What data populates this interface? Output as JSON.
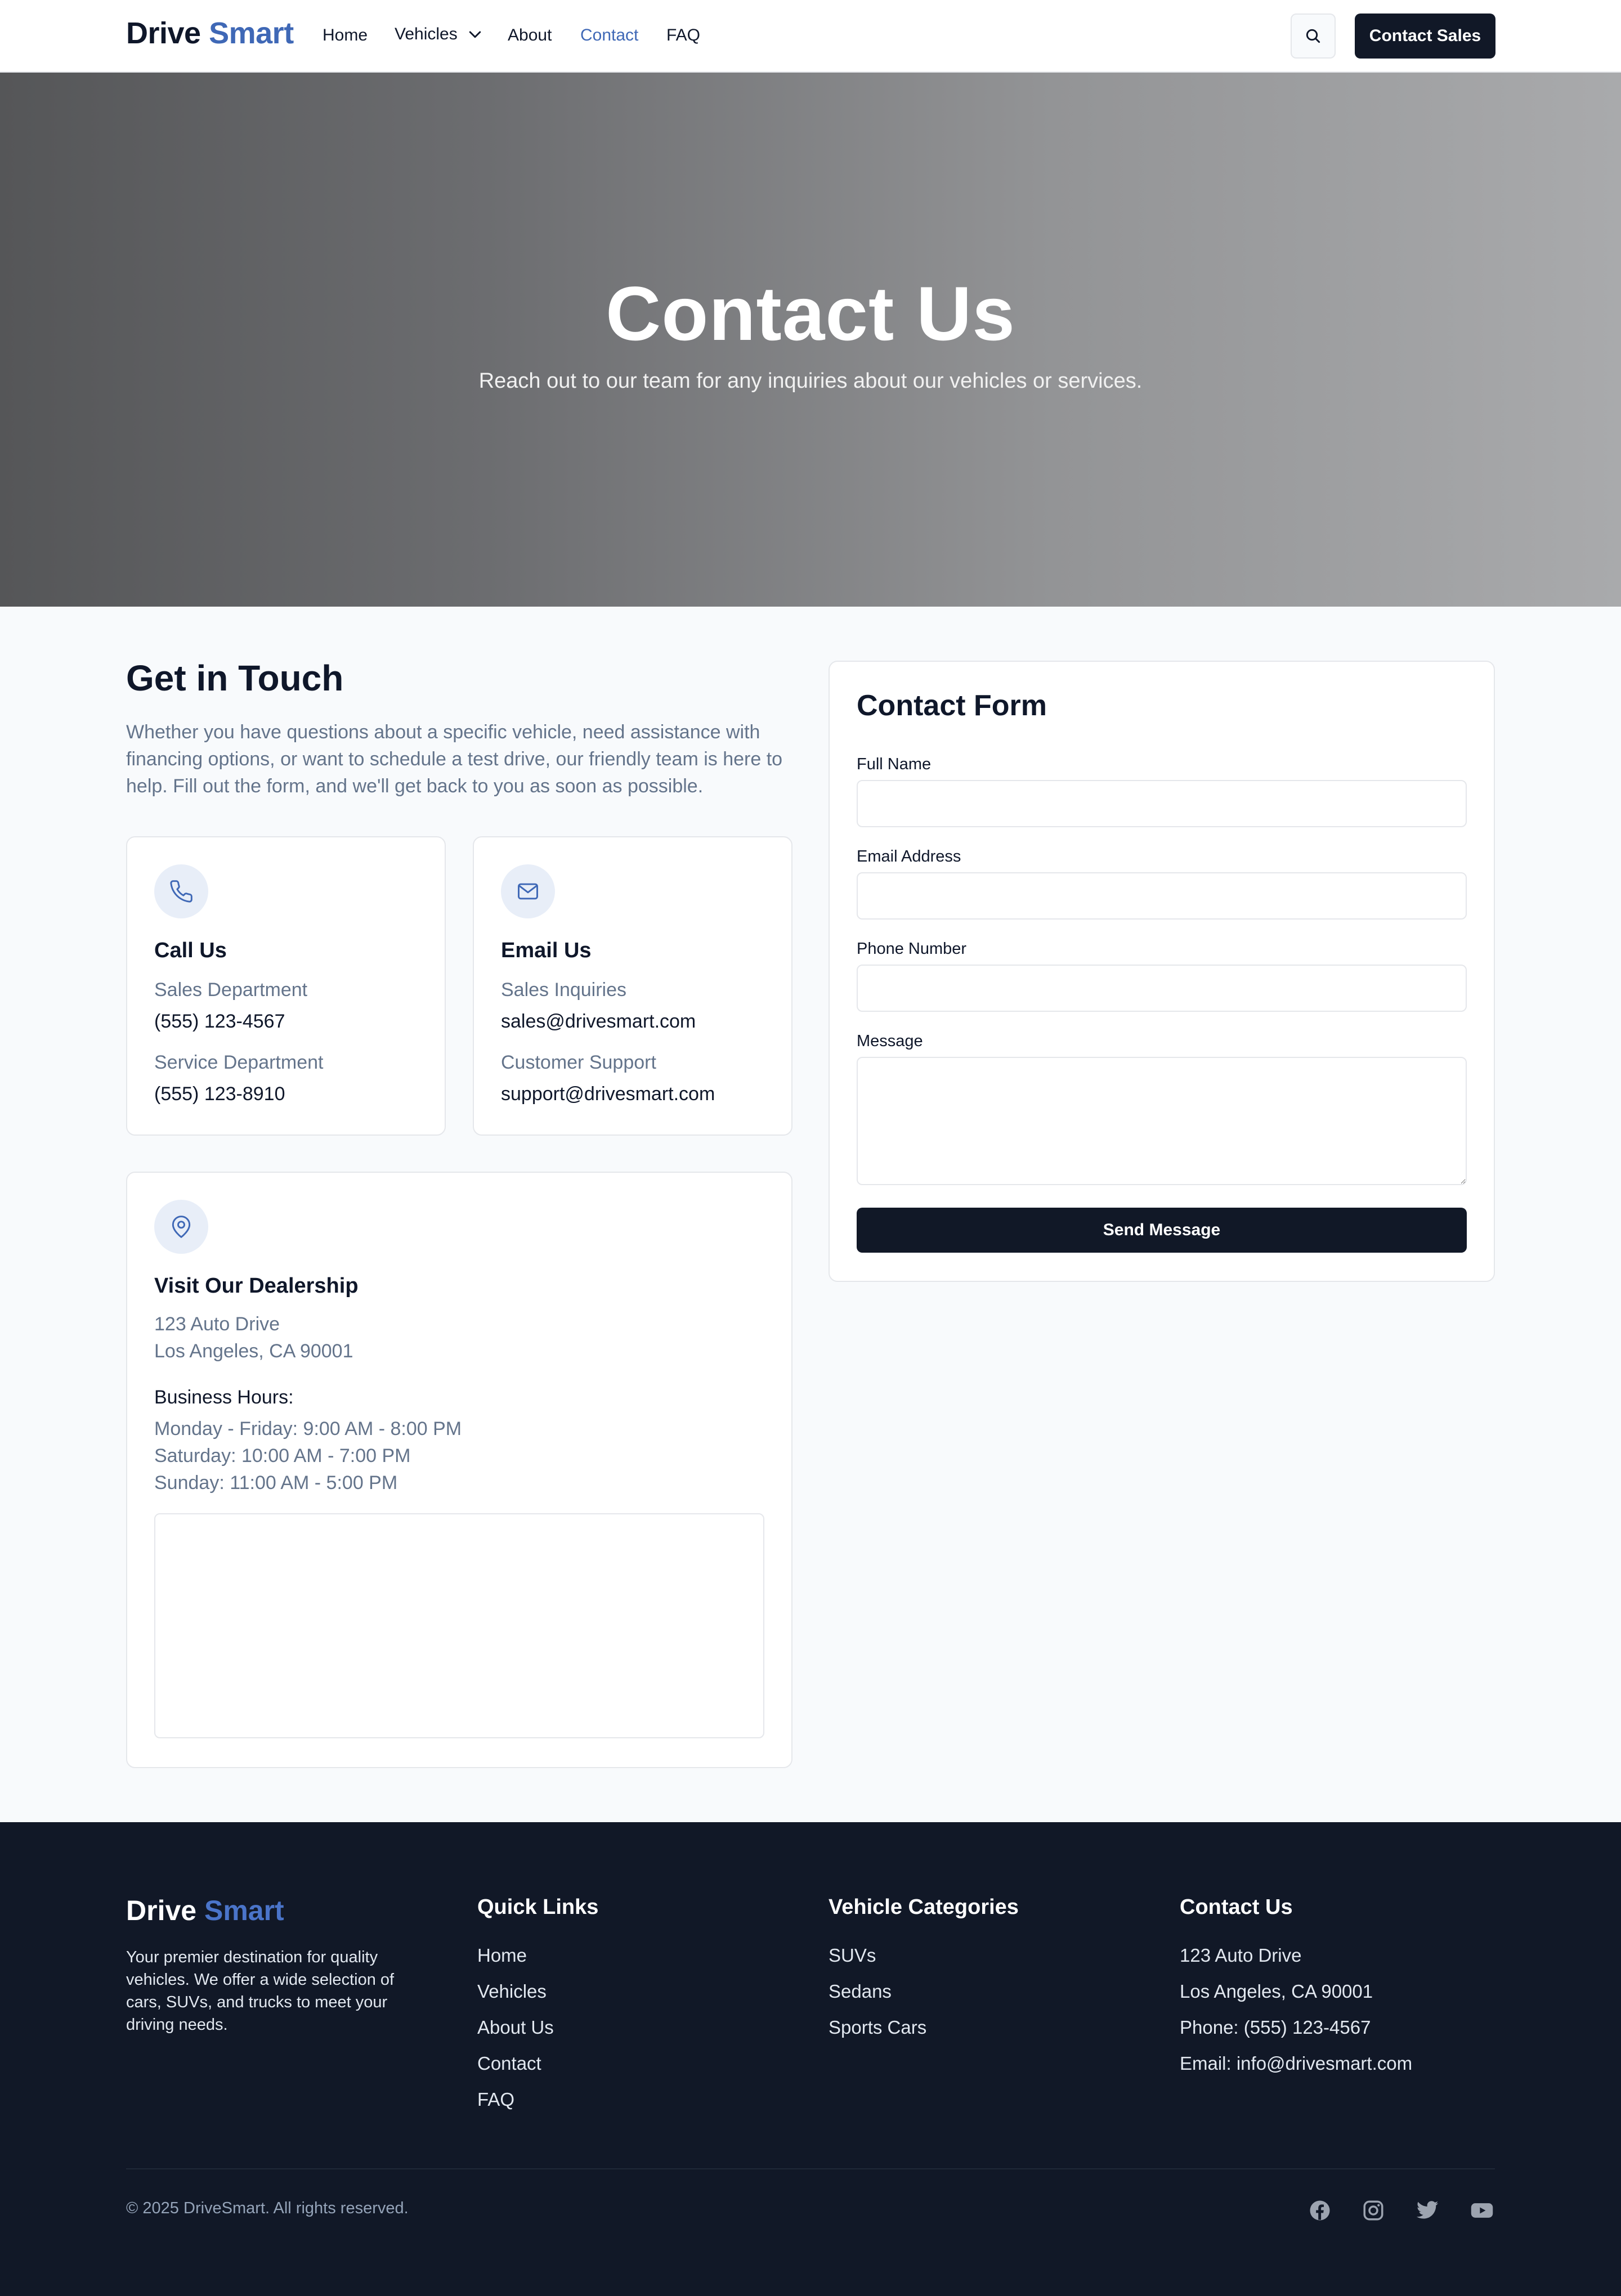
{
  "brand": {
    "part1": "Drive",
    "part2": "Smart"
  },
  "nav": {
    "items": [
      "Home",
      "Vehicles",
      "About",
      "Contact",
      "FAQ"
    ],
    "active": "Contact",
    "cta": "Contact Sales"
  },
  "hero": {
    "title": "Contact Us",
    "subtitle": "Reach out to our team for any inquiries about our vehicles or services."
  },
  "touch": {
    "title": "Get in Touch",
    "description": "Whether you have questions about a specific vehicle, need assistance with financing options, or want to schedule a test drive, our friendly team is here to help. Fill out the form, and we'll get back to you as soon as possible."
  },
  "call": {
    "title": "Call Us",
    "items": [
      {
        "label": "Sales Department",
        "value": "(555) 123-4567"
      },
      {
        "label": "Service Department",
        "value": "(555) 123-8910"
      }
    ]
  },
  "email": {
    "title": "Email Us",
    "items": [
      {
        "label": "Sales Inquiries",
        "value": "sales@drivesmart.com"
      },
      {
        "label": "Customer Support",
        "value": "support@drivesmart.com"
      }
    ]
  },
  "visit": {
    "title": "Visit Our Dealership",
    "address": [
      "123 Auto Drive",
      "Los Angeles, CA 90001"
    ],
    "hours_title": "Business Hours:",
    "hours": [
      "Monday - Friday: 9:00 AM - 8:00 PM",
      "Saturday: 10:00 AM - 7:00 PM",
      "Sunday: 11:00 AM - 5:00 PM"
    ]
  },
  "form": {
    "title": "Contact Form",
    "fields": [
      {
        "label": "Full Name",
        "value": "",
        "placeholder": ""
      },
      {
        "label": "Email Address",
        "value": "",
        "placeholder": ""
      },
      {
        "label": "Phone Number",
        "value": "",
        "placeholder": ""
      },
      {
        "label": "Message",
        "value": "",
        "placeholder": ""
      }
    ],
    "submit": "Send Message"
  },
  "footer": {
    "about": "Your premier destination for quality vehicles. We offer a wide selection of cars, SUVs, and trucks to meet your driving needs.",
    "quick_links": {
      "title": "Quick Links",
      "items": [
        "Home",
        "Vehicles",
        "About Us",
        "Contact",
        "FAQ"
      ]
    },
    "categories": {
      "title": "Vehicle Categories",
      "items": [
        "SUVs",
        "Sedans",
        "Sports Cars"
      ]
    },
    "contact": {
      "title": "Contact Us",
      "items": [
        "123 Auto Drive",
        "Los Angeles, CA 90001",
        "Phone: (555) 123-4567",
        "Email: info@drivesmart.com"
      ]
    },
    "copyright": "© 2025 DriveSmart. All rights reserved.",
    "social": [
      "facebook-icon",
      "instagram-icon",
      "twitter-icon",
      "youtube-icon"
    ]
  },
  "colors": {
    "accent": "#3f68b6",
    "dark": "#111827",
    "muted": "#64748b",
    "background": "#f8fafc"
  }
}
